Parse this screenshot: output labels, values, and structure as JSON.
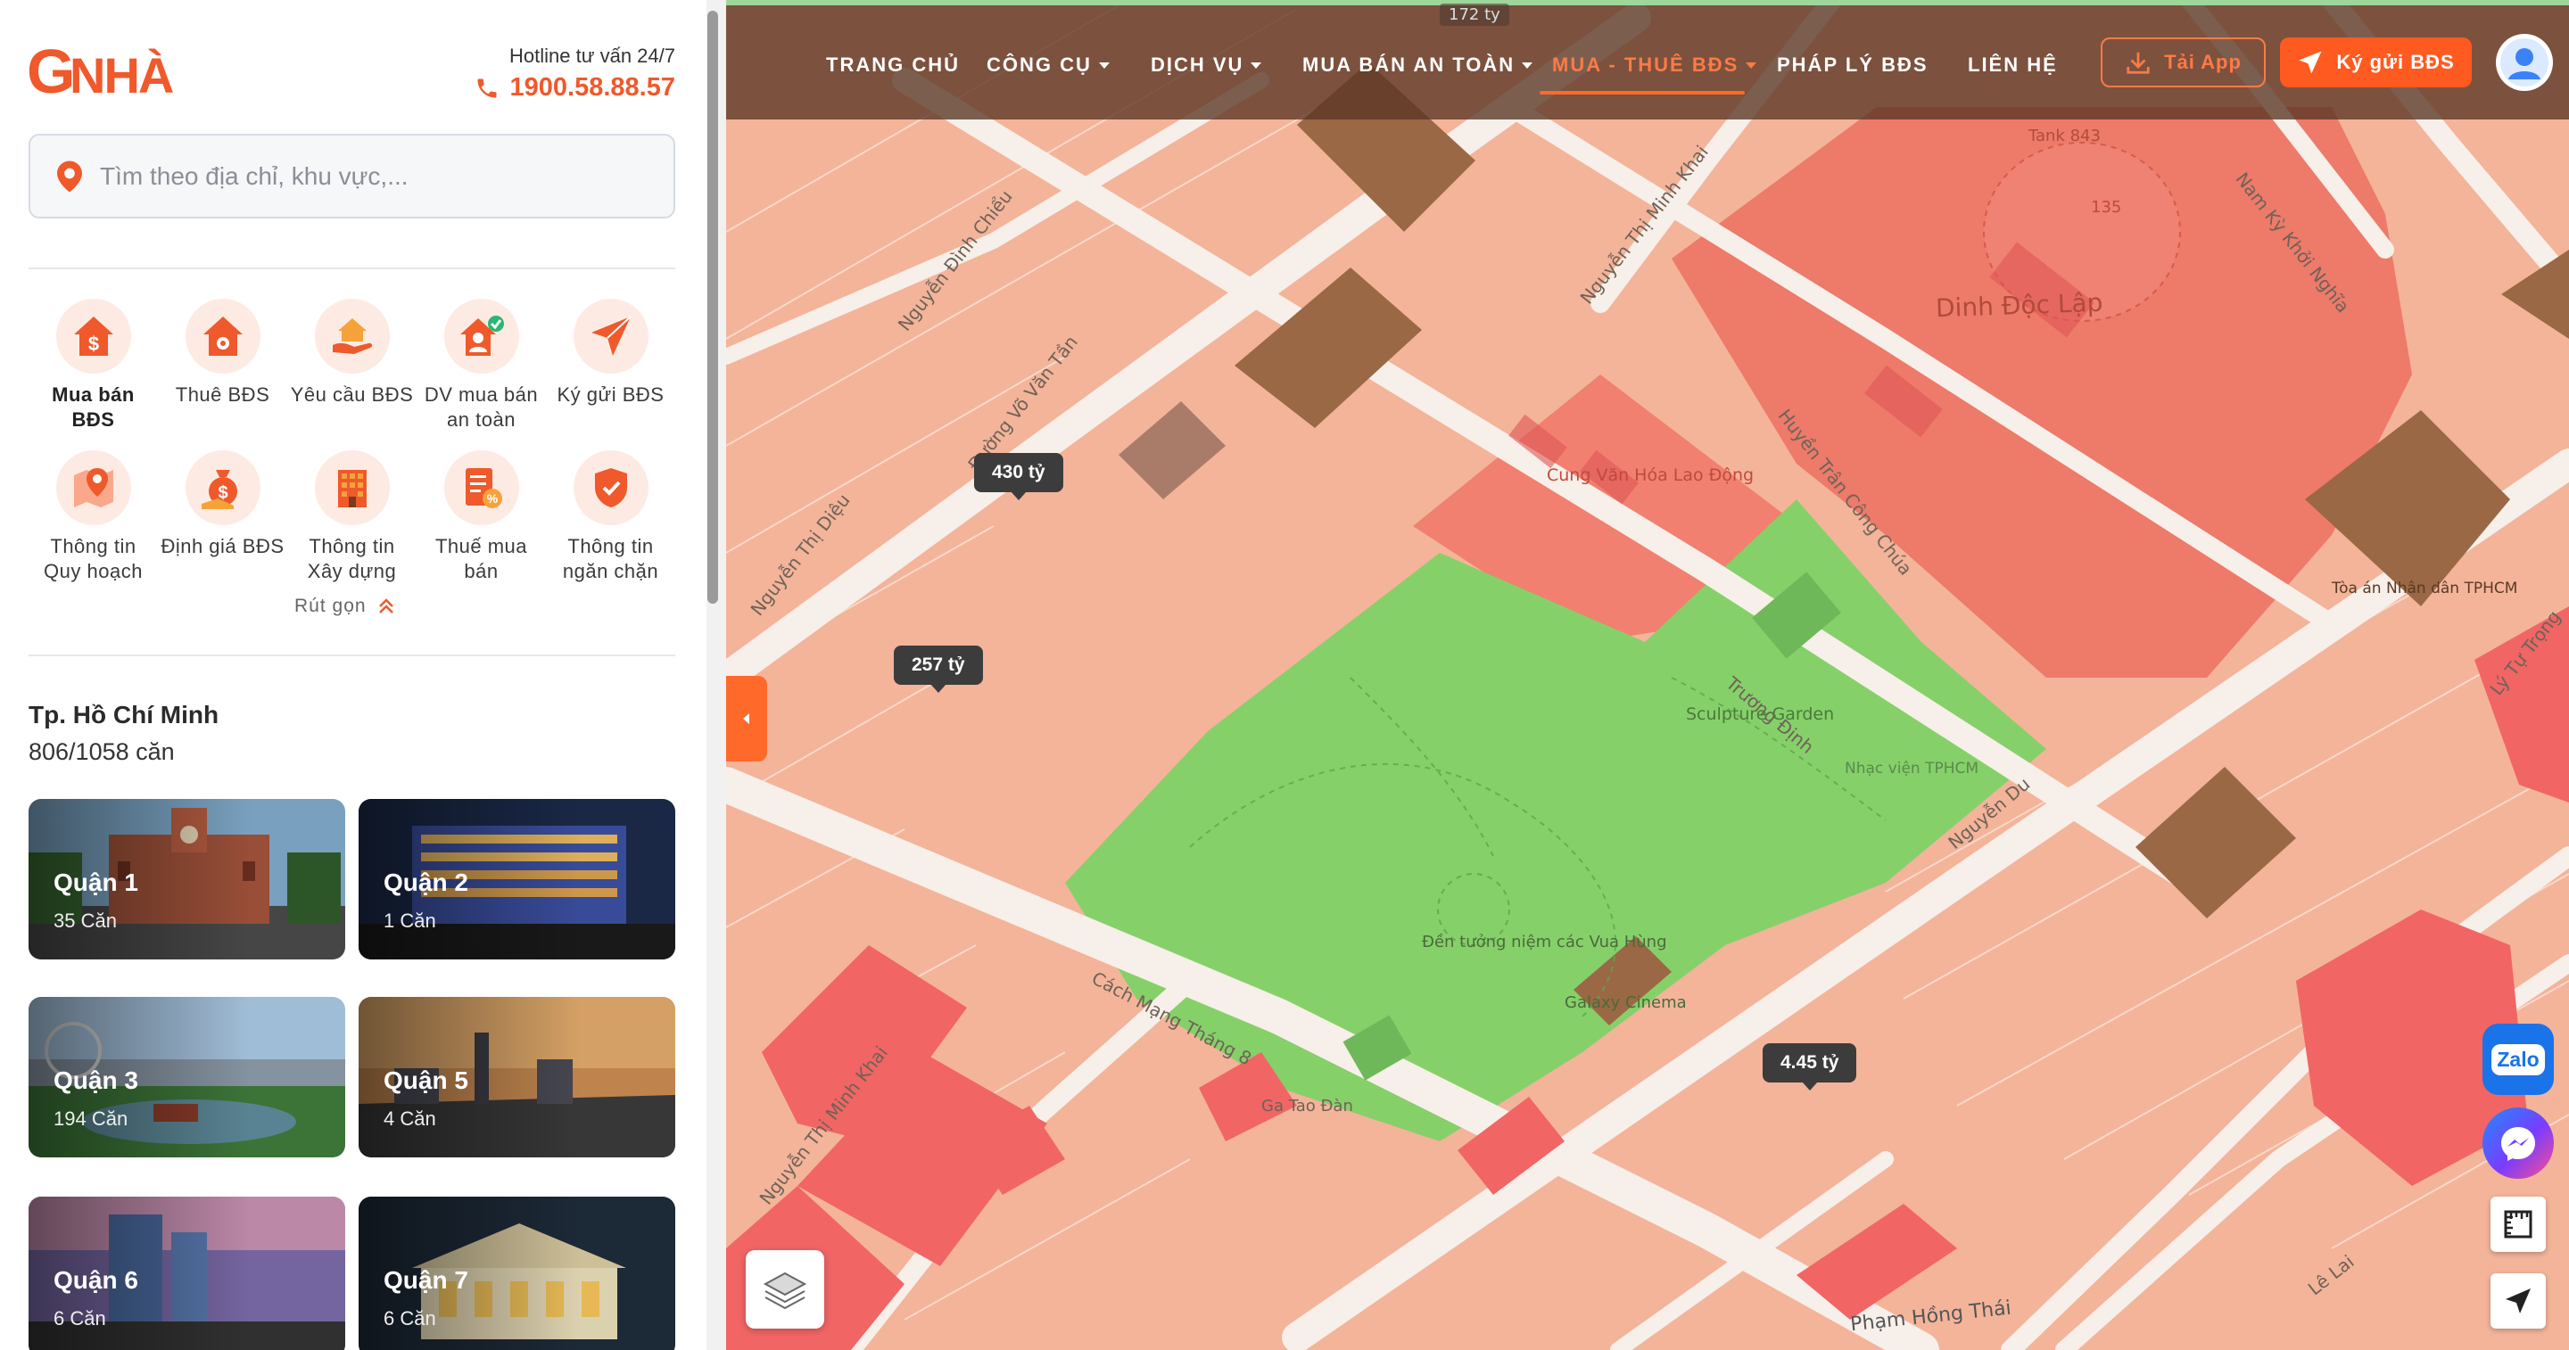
{
  "brand": {
    "logo_text": "GNHÀ",
    "accent": "#f0592b"
  },
  "hotline": {
    "label": "Hotline tư vấn 24/7",
    "number": "1900.58.88.57"
  },
  "search": {
    "placeholder": "Tìm theo địa chỉ, khu vực,..."
  },
  "services": [
    {
      "label": "Mua bán BĐS",
      "icon": "dollar-house-icon"
    },
    {
      "label": "Thuê BĐS",
      "icon": "house-icon"
    },
    {
      "label": "Yêu cầu BĐS",
      "icon": "hand-house-icon"
    },
    {
      "label": "DV mua bán an toàn",
      "icon": "safe-deal-icon"
    },
    {
      "label": "Ký gửi BĐS",
      "icon": "send-icon"
    },
    {
      "label": "Thông tin Quy hoạch",
      "icon": "map-pin-icon"
    },
    {
      "label": "Định giá BĐS",
      "icon": "money-bag-icon"
    },
    {
      "label": "Thông tin Xây dựng",
      "icon": "building-icon"
    },
    {
      "label": "Thuế mua bán",
      "icon": "tax-document-icon"
    },
    {
      "label": "Thông tin ngăn chặn",
      "icon": "shield-icon"
    }
  ],
  "collapse_label": "Rút gọn",
  "city": {
    "name": "Tp. Hồ Chí Minh",
    "count": "806/1058 căn"
  },
  "districts": [
    {
      "name": "Quận 1",
      "count": "35 Căn"
    },
    {
      "name": "Quận 2",
      "count": "1 Căn"
    },
    {
      "name": "Quận 3",
      "count": "194 Căn"
    },
    {
      "name": "Quận 5",
      "count": "4 Căn"
    },
    {
      "name": "Quận 6",
      "count": "6 Căn"
    },
    {
      "name": "Quận 7",
      "count": "6 Căn"
    }
  ],
  "nav": [
    {
      "label": "TRANG CHỦ",
      "dropdown": false
    },
    {
      "label": "CÔNG CỤ",
      "dropdown": true
    },
    {
      "label": "DỊCH VỤ",
      "dropdown": true
    },
    {
      "label": "MUA BÁN AN TOÀN",
      "dropdown": true
    },
    {
      "label": "MUA - THUÊ BĐS",
      "dropdown": true,
      "active": true
    },
    {
      "label": "PHÁP LÝ BĐS",
      "dropdown": false
    },
    {
      "label": "LIÊN HỆ",
      "dropdown": false
    }
  ],
  "buttons": {
    "app": "Tải App",
    "post": "Ký gửi BĐS"
  },
  "price_tags": [
    "430 tỷ",
    "257 tỷ",
    "4.45 tỷ"
  ],
  "float": {
    "zalo": "Zalo"
  },
  "map_labels": {
    "dinh_doc_lap": "Dinh Độc Lập",
    "truong_dinh": "Trương Định",
    "huyen_tran_cong_chua": "Huyền Trân Công Chúa",
    "cach_mang_thang_8": "Cách Mạng Tháng 8",
    "nguyen_thi_minh_khai": "Nguyễn Thị Minh Khai",
    "nguyen_du": "Nguyễn Du",
    "nam_ky_khoi_nghia": "Nam Kỳ Khởi Nghĩa",
    "pham_hong_thai": "Phạm Hồng Thái",
    "le_lai": "Lê Lai",
    "nguyen_dinh_chieu": "Nguyễn Đình Chiểu",
    "duong_vo_van_tan": "Đường Võ Văn Tần",
    "nguyen_thi_dieu": "Nguyễn Thị Diệu",
    "sculpture_garden": "Sculpture Garden",
    "cung_van_hoa": "Cung Văn Hóa Lao Động",
    "den_tuong_niem": "Đền tưởng niệm các Vua Hùng",
    "galaxy": "Galaxy Cinema",
    "ga_tao_dan": "Ga Tao Đàn",
    "tank": "Tank 843",
    "toa_an": "Tòa án Nhân dân TPHCM",
    "elev": "172 ty",
    "ly_tu_trong": "Lý Tự Trọng",
    "nhac_vien": "Nhạc viện TPHCM",
    "num135": "135"
  }
}
